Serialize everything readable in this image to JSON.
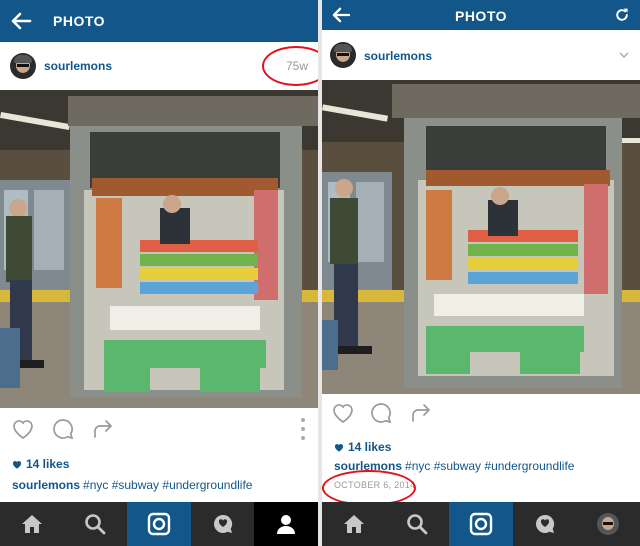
{
  "left": {
    "header": {
      "title": "PHOTO",
      "back_icon": "arrow-left-icon"
    },
    "user": {
      "name": "sourlemons",
      "time_ago": "75w"
    },
    "likes": "14 likes",
    "caption": {
      "user": "sourlemons",
      "tags": "#nyc #subway #undergroundlife"
    },
    "tabs": [
      "home-icon",
      "search-icon",
      "camera-icon",
      "activity-icon",
      "profile-icon"
    ]
  },
  "right": {
    "header": {
      "title": "PHOTO",
      "back_icon": "arrow-left-icon",
      "refresh_icon": "refresh-icon"
    },
    "user": {
      "name": "sourlemons"
    },
    "likes": "14 likes",
    "caption": {
      "user": "sourlemons",
      "tags": "#nyc #subway #undergroundlife"
    },
    "date": "OCTOBER 6, 2014",
    "tabs": [
      "home-icon",
      "search-icon",
      "camera-icon",
      "activity-icon",
      "profile-avatar"
    ]
  },
  "colors": {
    "brand_blue": "#12568a",
    "tabbar": "#2b2b2b",
    "annotation_red": "#e0121b",
    "muted": "#999999"
  }
}
